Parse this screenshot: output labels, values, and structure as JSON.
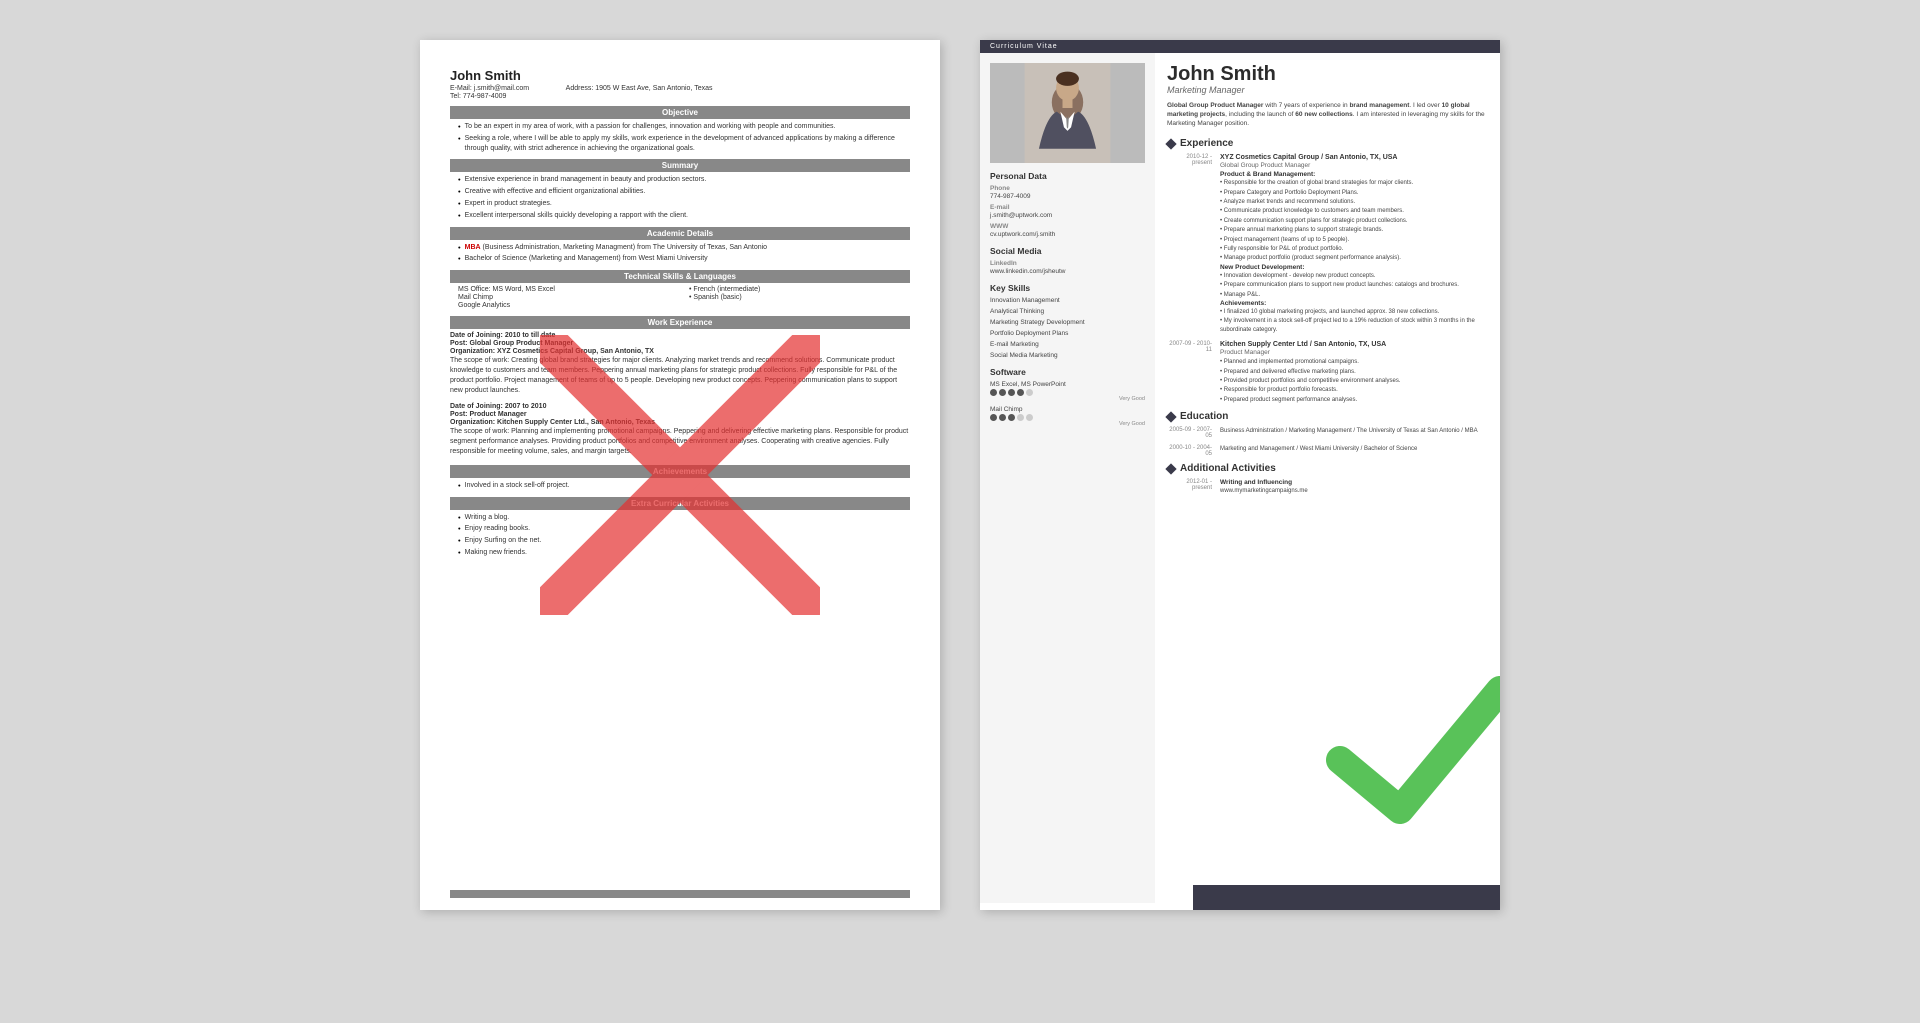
{
  "page": {
    "background_color": "#d8d8d8"
  },
  "left_resume": {
    "name": "John Smith",
    "email_label": "E-Mail:",
    "email": "j.smith@mail.com",
    "address_label": "Address:",
    "address": "1905 W East Ave, San Antonio, Texas",
    "tel_label": "Tel:",
    "tel": "774-987-4009",
    "sections": {
      "objective": {
        "title": "Objective",
        "bullets": [
          "To be an expert in my area of work, with a passion for challenges, innovation and working with people and communities.",
          "Seeking a role, where I will be able to apply my skills, work experience in the development of advanced applications by making a difference through quality, with strict adherence in achieving the organizational goals."
        ]
      },
      "summary": {
        "title": "Summary",
        "bullets": [
          "Extensive experience in brand management in beauty and production sectors.",
          "Creative with effective and efficient organizational abilities.",
          "Expert in product strategies.",
          "Excellent interpersonal skills quickly developing a rapport with the client."
        ]
      },
      "academic": {
        "title": "Academic Details",
        "items": [
          "MBA (Business Administration, Marketing Managment) from The University of Texas, San Antonio",
          "Bachelor of Science (Marketing and Management) from West Miami University"
        ]
      },
      "technical": {
        "title": "Technical Skills & Languages",
        "left_skills": [
          "MS Office: MS Word, MS Excel",
          "Mail Chimp",
          "Google Analytics"
        ],
        "right_skills": [
          "French (intermediate)",
          "Spanish (basic)"
        ]
      },
      "work": {
        "title": "Work Experience",
        "jobs": [
          {
            "date_of_joining": "Date of Joining: 2010 to till date",
            "post": "Post: Global Group Product Manager",
            "organization": "Organization: XYZ Cosmetics Capital Group, San Antonio, TX",
            "scope": "The scope of work: Creating global brand strategies for major clients. Analyzing market trends and recommend solutions. Communicate product knowledge to customers and team members. Peppering annual marketing plans for strategic product collections. Fully responsible for P&L of the product portfolio. Project management of teams of up to 5 people. Developing new product concepts. Peppering communication plans to support new product launches."
          },
          {
            "date_of_joining": "Date of Joining: 2007 to 2010",
            "post": "Post: Product Manager",
            "organization": "Organization: Kitchen Supply Center Ltd., San Antonio, Texas",
            "scope": "The scope of work: Planning and implementing promotional campaigns. Peppering and delivering effective marketing plans. Responsible for product segment performance analyses. Providing product portfolios and competitive environment analyses. Cooperating with creative agencies. Fully responsible for meeting volume, sales, and margin targets."
          }
        ]
      },
      "achievements": {
        "title": "Achievements",
        "items": [
          "Involved in a stock sell-off project."
        ]
      },
      "extra": {
        "title": "Extra Curricular Activities",
        "items": [
          "Writing a blog.",
          "Enjoy reading books.",
          "Enjoy Surfing on the net.",
          "Making new friends."
        ]
      }
    }
  },
  "right_resume": {
    "cv_label": "Curriculum Vitae",
    "name": "John Smith",
    "title": "Marketing Manager",
    "summary": "Global Group Product Manager with 7 years of experience in brand management. I led over 10 global marketing projects, including the launch of 60 new collections. I am interested in leveraging my skills for the Marketing Manager position.",
    "sidebar": {
      "photo_alt": "Professional headshot",
      "personal_data_title": "Personal Data",
      "phone_label": "Phone",
      "phone": "774-987-4009",
      "email_label": "E-mail",
      "email": "j.smith@uptwork.com",
      "www_label": "WWW",
      "www": "cv.uptwork.com/j.smith",
      "social_title": "Social Media",
      "linkedin_label": "LinkedIn",
      "linkedin": "www.linkedin.com/jsheutw",
      "skills_title": "Key Skills",
      "skills": [
        "Innovation Management",
        "Analytical Thinking",
        "Marketing Strategy Development",
        "Portfolio Deployment Plans",
        "E-mail Marketing",
        "Social Media Marketing"
      ],
      "software_title": "Software",
      "software": [
        {
          "name": "MS Excel, MS PowerPoint",
          "level": 4,
          "label": "Very Good"
        },
        {
          "name": "Mail Chimp",
          "level": 3,
          "label": "Very Good"
        }
      ]
    },
    "main": {
      "experience_title": "Experience",
      "jobs": [
        {
          "dates": "2010-12 - present",
          "company": "XYZ Cosmetics Capital Group / San Antonio, TX, USA",
          "role": "Global Group Product Manager",
          "sections": [
            {
              "label": "Product & Brand Management:",
              "bullets": [
                "Responsible for the creation of global brand strategies for major clients.",
                "Prepare Category and Portfolio Deployment Plans.",
                "Analyze market trends and recommend solutions.",
                "Communicate product knowledge to customers and team members.",
                "Create communication support plans for strategic product collections.",
                "Prepare annual marketing plans to support strategic brands.",
                "Project management (teams of up to 5 people).",
                "Fully responsible for P&L of product portfolio.",
                "Manage product portfolio (product segment performance analysis)."
              ]
            },
            {
              "label": "New Product Development:",
              "bullets": [
                "Innovation development - develop new product concepts.",
                "Prepare communication plans to support new product launches: catalogs and brochures.",
                "Manage P&L."
              ]
            },
            {
              "label": "Achievements:",
              "bullets": [
                "I finalized 10 global marketing projects, and launched approx. 38 new collections.",
                "My involvement in a stock sell-off project led to a 19% reduction of stock within 3 months in the subordinate category."
              ]
            }
          ]
        },
        {
          "dates": "2007-09 - 2010-11",
          "company": "Kitchen Supply Center Ltd / San Antonio, TX, USA",
          "role": "Product Manager",
          "bullets": [
            "Planned and implemented promotional campaigns.",
            "Prepared and delivered effective marketing plans.",
            "Provided product portfolios and competitive environment analyses.",
            "Responsible for product portfolio forecasts.",
            "Prepared product segment performance analyses."
          ]
        }
      ],
      "education_title": "Education",
      "education": [
        {
          "dates": "2005-09 - 2007-05",
          "details": "Business Administration / Marketing Management / The University of Texas at San Antonio / MBA"
        },
        {
          "dates": "2000-10 - 2004-05",
          "details": "Marketing and Management / West Miami University / Bachelor of Science"
        }
      ],
      "activities_title": "Additional Activities",
      "activities": [
        {
          "dates": "2012-01 - present",
          "label": "Writing and Influencing",
          "value": "www.mymarketingcampaigns.me"
        }
      ]
    }
  }
}
